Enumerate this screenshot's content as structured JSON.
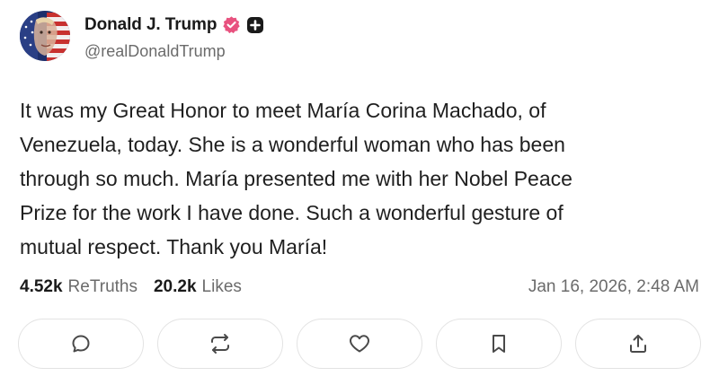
{
  "author": {
    "display_name": "Donald J. Trump",
    "handle": "@realDonaldTrump",
    "verified_badge_color": "#e8527f"
  },
  "post": {
    "lines": [
      "It was my Great Honor to meet María Corina Machado, of",
      "Venezuela, today. She is a wonderful woman who has been",
      "through so much. María presented me with her Nobel Peace",
      "Prize for the work I have done. Such a wonderful gesture of",
      "mutual respect. Thank you María!"
    ]
  },
  "stats": {
    "retruths_count": "4.52k",
    "retruths_label": "ReTruths",
    "likes_count": "20.2k",
    "likes_label": "Likes",
    "timestamp": "Jan 16, 2026, 2:48 AM"
  },
  "actions": [
    {
      "icon": "comment-icon"
    },
    {
      "icon": "retruth-icon"
    },
    {
      "icon": "heart-icon"
    },
    {
      "icon": "bookmark-icon"
    },
    {
      "icon": "share-icon"
    }
  ],
  "colors": {
    "icon_stroke": "#4a4a4a",
    "muted_text": "#6b6b6b",
    "border": "#e3e3e3"
  }
}
